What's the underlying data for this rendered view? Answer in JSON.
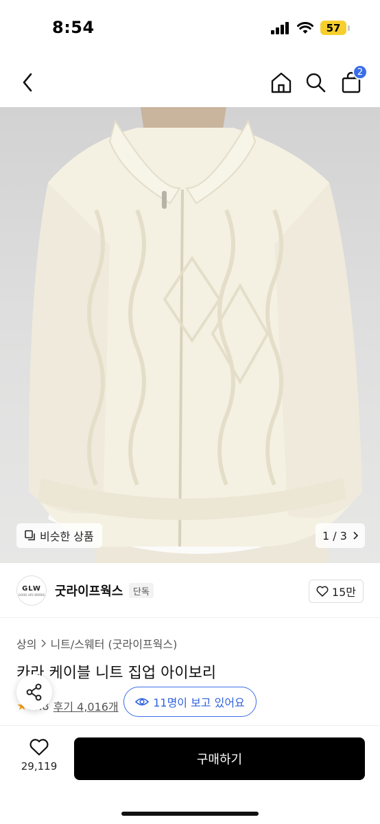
{
  "status": {
    "time": "8:54",
    "battery": "57"
  },
  "nav": {
    "cart_count": "2"
  },
  "hero": {
    "similar_label": "비슷한 상품",
    "pager_text": "1 / 3"
  },
  "brand": {
    "logo_text": "GLW",
    "logo_sub": "GOOD LIFE WORKS",
    "name": "굿라이프웍스",
    "badge": "단독",
    "likes": "15만"
  },
  "product": {
    "breadcrumb": [
      "상의",
      "니트/스웨터 (굿라이프웍스)"
    ],
    "title": "카라 케이블 니트 집업 아이보리",
    "rating": "4.8",
    "review_label": "후기 4,016개"
  },
  "viewers": "11명이 보고 있어요",
  "bottom": {
    "wish_count": "29,119",
    "buy_label": "구매하기"
  },
  "colors": {
    "accent": "#3a6de8",
    "buy_bg": "#000000",
    "battery": "#f7cf2c",
    "sweater": "#f4f1e3"
  }
}
